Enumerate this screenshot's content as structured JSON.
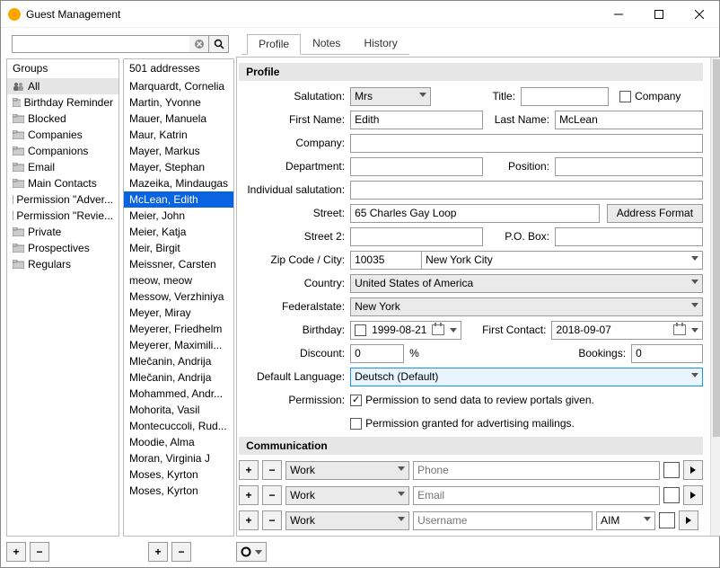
{
  "window": {
    "title": "Guest Management"
  },
  "search": {
    "placeholder": ""
  },
  "tabs": [
    "Profile",
    "Notes",
    "History"
  ],
  "activeTab": 0,
  "groupsHeader": "Groups",
  "groups": [
    "All",
    "Birthday Reminder",
    "Blocked",
    "Companies",
    "Companions",
    "Email",
    "Main Contacts",
    "Permission \"Adver...",
    "Permission \"Revie...",
    "Private",
    "Prospectives",
    "Regulars"
  ],
  "addressHeader": "501 addresses",
  "addresses": [
    "Marquardt, Cornelia",
    "Martin, Yvonne",
    "Mauer, Manuela",
    "Maur, Katrin",
    "Mayer, Markus",
    "Mayer, Stephan",
    "Mazeika, Mindaugas",
    "McLean, Edith",
    "Meier, John",
    "Meier, Katja",
    "Meir, Birgit",
    "Meissner, Carsten",
    "meow, meow",
    "Messow, Verzhiniya",
    "Meyer, Miray",
    "Meyerer, Friedhelm",
    "Meyerer, Maximili...",
    "Mlečanin, Andrija",
    "Mlečanin, Andrija",
    "Mohammed, Andr...",
    "Mohorita, Vasil",
    "Montecuccoli, Rud...",
    "Moodie, Alma",
    "Moran, Virginia J",
    "Moses, Kyrton",
    "Moses, Kyrton"
  ],
  "selectedAddressIndex": 7,
  "profile": {
    "sectionTitle": "Profile",
    "labels": {
      "salutation": "Salutation:",
      "title": "Title:",
      "company_chk": "Company",
      "firstName": "First Name:",
      "lastName": "Last Name:",
      "company": "Company:",
      "department": "Department:",
      "position": "Position:",
      "indSal": "Individual salutation:",
      "street": "Street:",
      "addrFormat": "Address Format",
      "street2": "Street 2:",
      "pobox": "P.O. Box:",
      "zipcity": "Zip Code / City:",
      "country": "Country:",
      "fedstate": "Federalstate:",
      "birthday": "Birthday:",
      "firstContact": "First Contact:",
      "discount": "Discount:",
      "pct": "%",
      "bookings": "Bookings:",
      "defLang": "Default Language:",
      "permission": "Permission:",
      "perm1": "Permission to send data to review portals given.",
      "perm2": "Permission granted for advertising mailings."
    },
    "values": {
      "salutation": "Mrs",
      "title": "",
      "firstName": "Edith",
      "lastName": "McLean",
      "company": "",
      "department": "",
      "position": "",
      "indSal": "",
      "street": "65 Charles Gay Loop",
      "street2": "",
      "pobox": "",
      "zip": "10035",
      "city": "New York City",
      "country": "United States of America",
      "fedstate": "New York",
      "birthday": "1999-08-21",
      "firstContact": "2018-09-07",
      "discount": "0",
      "bookings": "0",
      "defLang": "Deutsch (Default)"
    }
  },
  "communication": {
    "sectionTitle": "Communication",
    "rows": [
      {
        "type": "Work",
        "ph": "Phone",
        "svc": null
      },
      {
        "type": "Work",
        "ph": "Email",
        "svc": null
      },
      {
        "type": "Work",
        "ph": "Username",
        "svc": "AIM"
      }
    ]
  }
}
